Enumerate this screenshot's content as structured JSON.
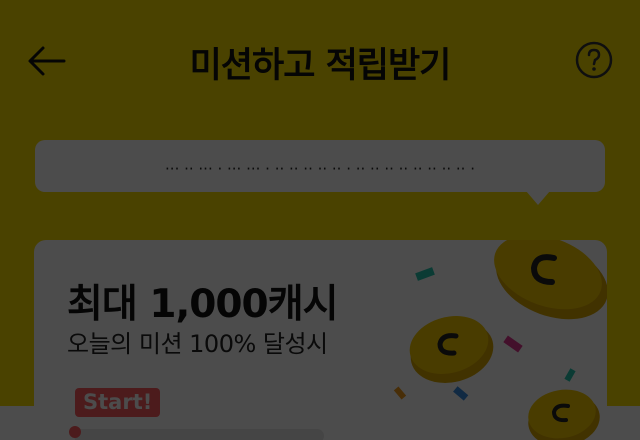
{
  "header": {
    "title": "미션하고 적립받기",
    "back_icon": "arrow-left-icon",
    "help_icon": "question-circle-icon"
  },
  "tooltip": {
    "text": "··· ·· ··· · ··· ··· · ·· ·· ·· ·· ·· · ·· ·· ·· ·· ·· ·· ·· ·· ·"
  },
  "mission_card": {
    "title": "최대 1,000캐시",
    "subtitle": "오늘의 미션 100% 달성시",
    "start_badge": "Start!",
    "progress": 0,
    "illustration": "gold-coins-confetti"
  },
  "colors": {
    "background": "#f7dd00",
    "card": "#ffffff",
    "accent": "#ff5a5f",
    "coin": "#f5c800",
    "overlay": "rgba(0,0,0,0.7)"
  }
}
